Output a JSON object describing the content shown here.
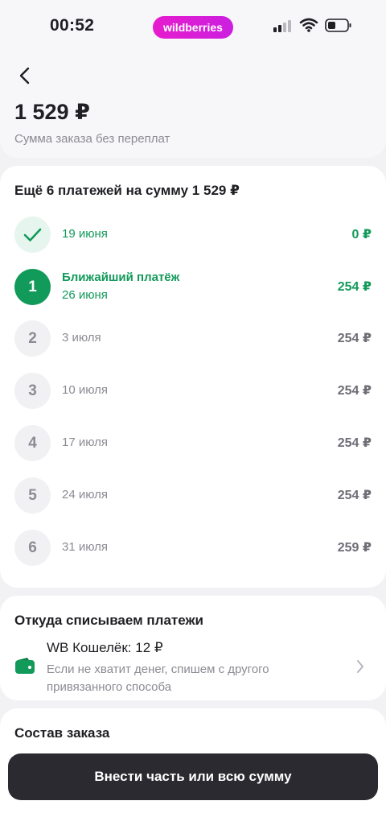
{
  "status_bar": {
    "time": "00:52",
    "brand": "wildberries"
  },
  "header": {
    "total": "1 529 ₽",
    "caption": "Сумма заказа без переплат"
  },
  "schedule": {
    "title": "Ещё 6 платежей на сумму 1 529 ₽",
    "paid": {
      "date": "19 июня",
      "amount": "0 ₽"
    },
    "next": {
      "number": "1",
      "label": "Ближайший платёж",
      "date": "26 июня",
      "amount": "254 ₽"
    },
    "rows": [
      {
        "number": "2",
        "date": "3 июля",
        "amount": "254 ₽"
      },
      {
        "number": "3",
        "date": "10 июля",
        "amount": "254 ₽"
      },
      {
        "number": "4",
        "date": "17 июля",
        "amount": "254 ₽"
      },
      {
        "number": "5",
        "date": "24 июля",
        "amount": "254 ₽"
      },
      {
        "number": "6",
        "date": "31 июля",
        "amount": "259 ₽"
      }
    ]
  },
  "source": {
    "title": "Откуда списываем платежи",
    "wallet_name": "WB Кошелёк: 12 ₽",
    "wallet_note": "Если не хватит денег, спишем с другого привязанного способа"
  },
  "order": {
    "title": "Состав заказа"
  },
  "actions": {
    "pay_label": "Внести часть или всю сумму"
  },
  "colors": {
    "accent_green": "#129a5a",
    "brand_pink": "#e61ccd",
    "button_dark": "#2a2a30"
  },
  "icons": [
    "signal-icon",
    "wifi-icon",
    "battery-icon",
    "back-arrow-icon",
    "check-icon",
    "wallet-icon",
    "chevron-right-icon"
  ]
}
